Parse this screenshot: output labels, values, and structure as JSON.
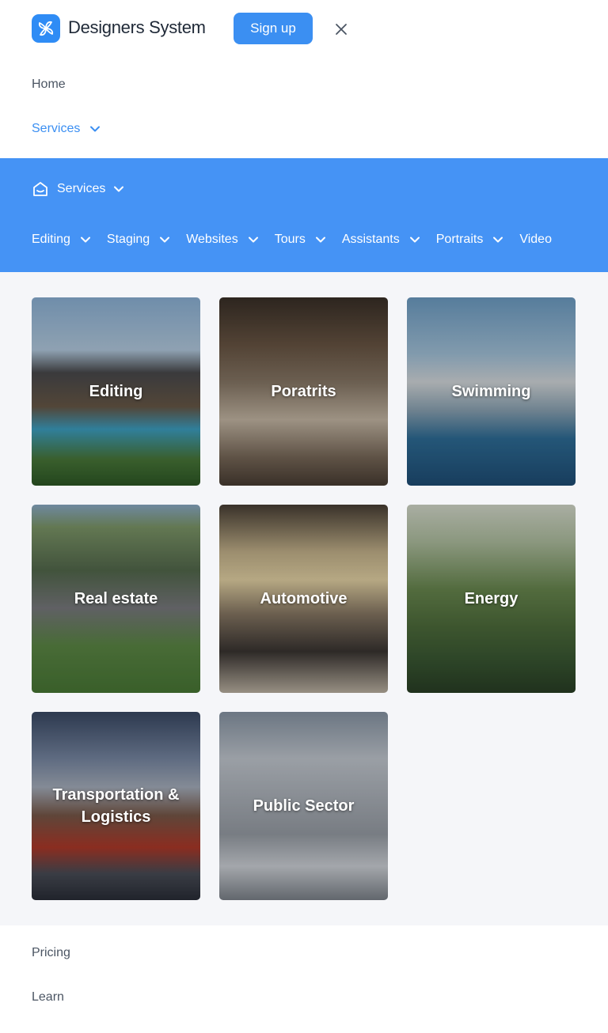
{
  "header": {
    "brand": "Designers System",
    "signup_label": "Sign up",
    "logo_icon": "pinwheel-logo-icon",
    "close_icon": "close-icon"
  },
  "nav": {
    "home": "Home",
    "services": "Services",
    "pricing": "Pricing",
    "learn": "Learn"
  },
  "panel": {
    "title": "Services",
    "title_icon": "home-icon",
    "items": [
      {
        "label": "Editing",
        "has_dropdown": true
      },
      {
        "label": "Staging",
        "has_dropdown": true
      },
      {
        "label": "Websites",
        "has_dropdown": true
      },
      {
        "label": "Tours",
        "has_dropdown": true
      },
      {
        "label": "Assistants",
        "has_dropdown": true
      },
      {
        "label": "Portraits",
        "has_dropdown": true
      },
      {
        "label": "Video",
        "has_dropdown": false
      }
    ]
  },
  "cards": [
    {
      "label": "Editing"
    },
    {
      "label": "Poratrits"
    },
    {
      "label": "Swimming"
    },
    {
      "label": "Real estate"
    },
    {
      "label": "Automotive"
    },
    {
      "label": "Energy"
    },
    {
      "label": "Transportation & Logistics"
    },
    {
      "label": "Public Sector"
    }
  ],
  "colors": {
    "accent": "#3b8ff2",
    "panel_bg": "#4593f5",
    "grid_bg": "#f5f6f9"
  }
}
